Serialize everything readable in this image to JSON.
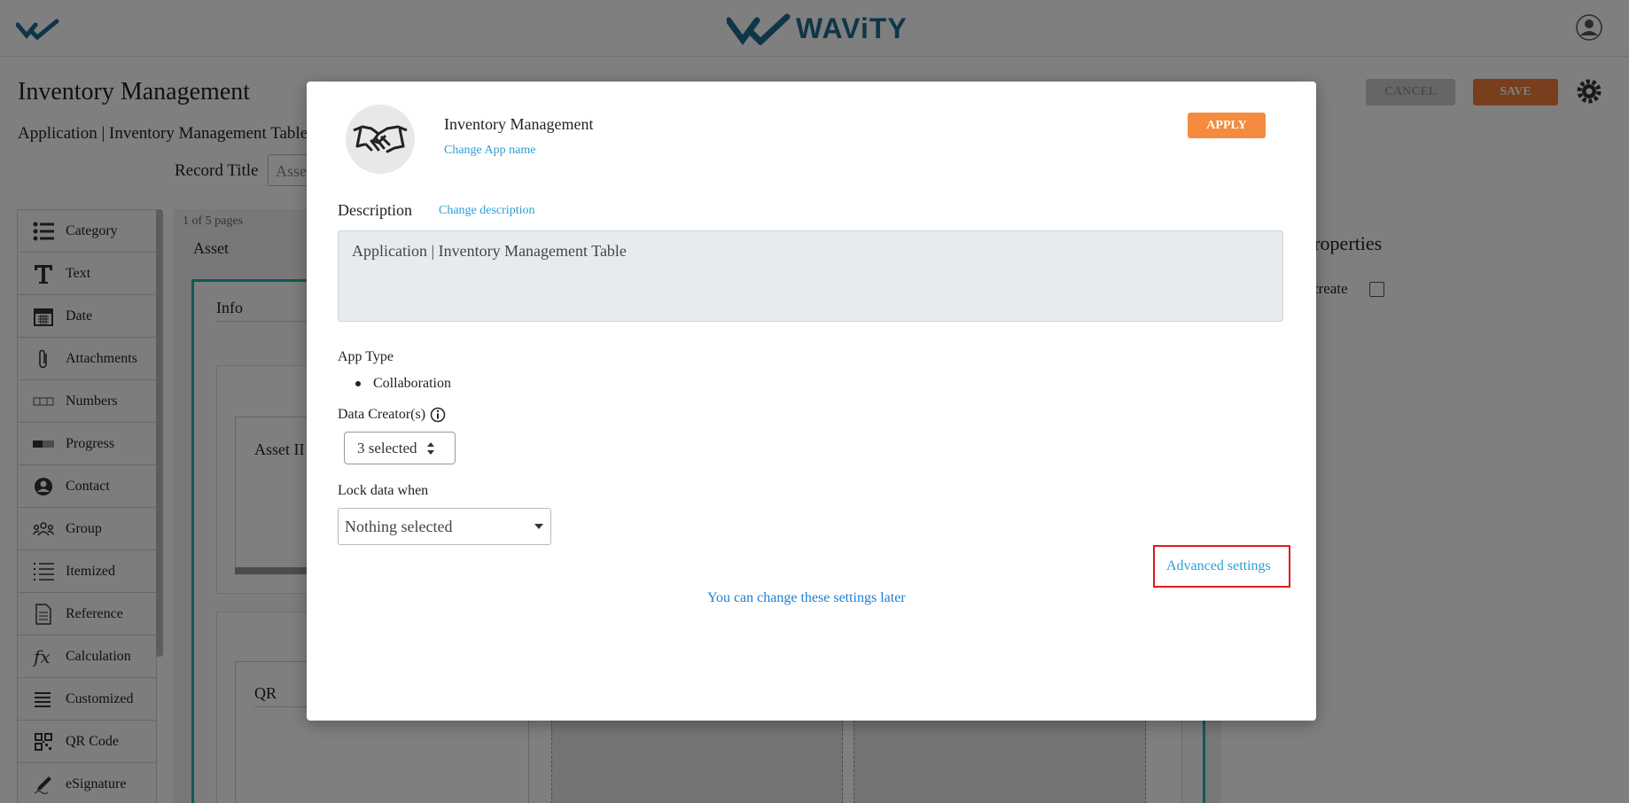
{
  "header": {
    "brand_name": "WAViTY"
  },
  "page": {
    "title": "Inventory Management",
    "subtitle": "Application | Inventory Management Table",
    "cancel_label": "CANCEL",
    "save_label": "SAVE",
    "record_title_label": "Record Title",
    "record_title_value": "Asset"
  },
  "palette": {
    "items": [
      {
        "label": "Category",
        "icon": "list-icon"
      },
      {
        "label": "Text",
        "icon": "text-icon"
      },
      {
        "label": "Date",
        "icon": "calendar-icon"
      },
      {
        "label": "Attachments",
        "icon": "paperclip-icon"
      },
      {
        "label": "Numbers",
        "icon": "numbers-icon"
      },
      {
        "label": "Progress",
        "icon": "progress-icon"
      },
      {
        "label": "Contact",
        "icon": "contact-icon"
      },
      {
        "label": "Group",
        "icon": "group-icon"
      },
      {
        "label": "Itemized",
        "icon": "itemized-icon"
      },
      {
        "label": "Reference",
        "icon": "document-icon"
      },
      {
        "label": "Calculation",
        "icon": "function-icon"
      },
      {
        "label": "Customized",
        "icon": "lines-icon"
      },
      {
        "label": "QR Code",
        "icon": "qr-icon"
      },
      {
        "label": "eSignature",
        "icon": "pen-icon"
      }
    ]
  },
  "canvas": {
    "pages_text": "1 of 5 pages",
    "page_tab": "Asset",
    "section_label": "Info",
    "field1_label": "Asset II",
    "field2_label": "QR"
  },
  "properties": {
    "title": "Properties",
    "create_label": "create"
  },
  "modal": {
    "app_name": "Inventory Management",
    "change_app_name": "Change App name",
    "apply_label": "APPLY",
    "description_label": "Description",
    "change_description": "Change description",
    "description_text": "Application | Inventory Management Table",
    "app_type_label": "App Type",
    "app_type_value": "Collaboration",
    "data_creators_label": "Data Creator(s)",
    "data_creators_value": "3 selected",
    "lock_label": "Lock data when",
    "lock_value": "Nothing selected",
    "advanced_settings": "Advanced settings",
    "footer_note": "You can change these settings later"
  },
  "colors": {
    "accent": "#f48b3e",
    "link": "#2a9fd6",
    "brand": "#1e6c90",
    "highlight": "#e01b1b",
    "panel_border": "#27b3a9"
  }
}
